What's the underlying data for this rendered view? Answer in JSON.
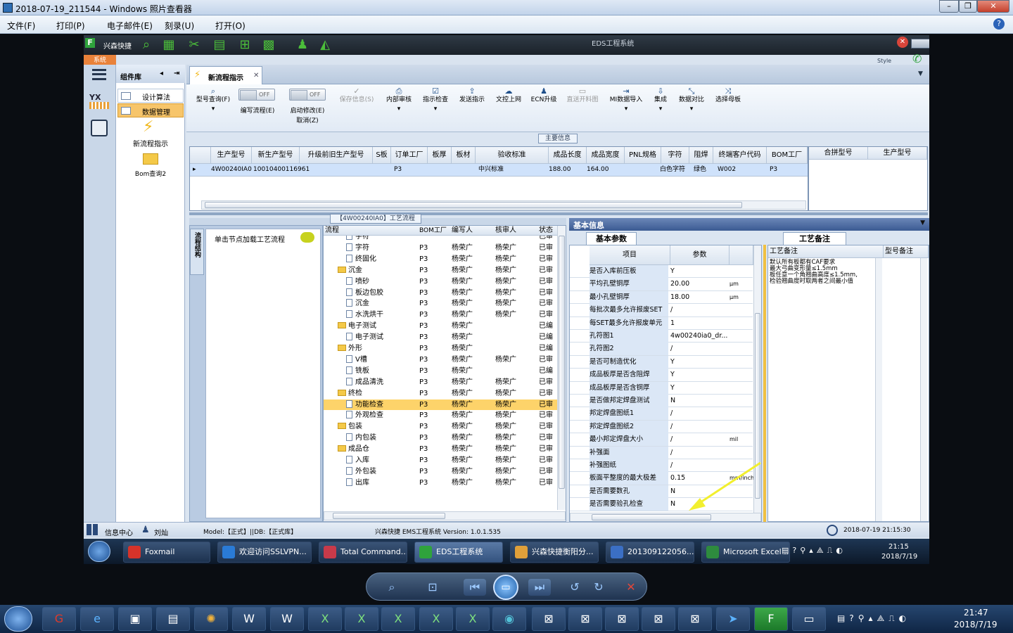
{
  "window": {
    "title": "2018-07-19_211544 - Windows 照片查看器"
  },
  "menu": [
    {
      "label": "文件(F)"
    },
    {
      "label": "打印(P)"
    },
    {
      "label": "电子邮件(E)"
    },
    {
      "label": "刻录(U)"
    },
    {
      "label": "打开(O)"
    }
  ],
  "eds": {
    "brand": "兴森快捷",
    "app_title": "EDS工程系统",
    "style_label": "Style",
    "sys_tab": "系统",
    "component_library": "组件库",
    "components": [
      {
        "label": "设计算法"
      },
      {
        "label": "数据管理"
      }
    ],
    "shortcuts": [
      {
        "label": "新流程指示"
      },
      {
        "label": "Bom查询2"
      }
    ],
    "tab": "新流程指示",
    "ribbon": {
      "query": "型号查询(F)",
      "toggle1": "OFF",
      "toggle1_label": "编写流程(E)",
      "toggle2": "OFF",
      "toggle2_label": "启动修改(E)",
      "cancel": "取消(Z)",
      "buttons": [
        {
          "label": "保存信息(S)"
        },
        {
          "label": "内部审核"
        },
        {
          "label": "指示检查"
        },
        {
          "label": "发送指示"
        },
        {
          "label": "文控上网"
        },
        {
          "label": "ECN升级"
        },
        {
          "label": "直送开料图"
        },
        {
          "label": "MI数据导入"
        },
        {
          "label": "集成"
        },
        {
          "label": "数据对比"
        },
        {
          "label": "选择母板"
        }
      ]
    },
    "main_info": "主要信息",
    "grid": {
      "headers": [
        "生产型号",
        "新生产型号",
        "升级前旧生产型号",
        "S板",
        "订单工厂",
        "板厚",
        "板材",
        "验收标准",
        "成品长度",
        "成品宽度",
        "PNL规格",
        "字符",
        "阻焊",
        "终端客户代码",
        "BOM工厂"
      ],
      "row": [
        "4W00240IA0",
        "10010400116961",
        "",
        "",
        "P3",
        "",
        "",
        "中兴标准",
        "188.00",
        "164.00",
        "",
        "白色字符",
        "绿色",
        "W002",
        "P3"
      ]
    },
    "merge_grid": {
      "headers": [
        "合拼型号",
        "生产型号"
      ]
    },
    "process_title": "【4W00240IA0】工艺流程",
    "struct_tab": "流程结构",
    "load_hint": "单击节点加载工艺流程",
    "tree": {
      "headers": [
        "流程",
        "BOM工厂",
        "编写人",
        "核审人",
        "状态"
      ],
      "rows": [
        {
          "name": "字符",
          "level": 2,
          "bom": "",
          "writer": "",
          "checker": "",
          "status": "已审"
        },
        {
          "name": "字符",
          "level": 2,
          "bom": "P3",
          "writer": "杨荣广",
          "checker": "杨荣广",
          "status": "已审"
        },
        {
          "name": "终固化",
          "level": 2,
          "bom": "P3",
          "writer": "杨荣广",
          "checker": "杨荣广",
          "status": "已审"
        },
        {
          "name": "沉金",
          "level": 1,
          "bom": "P3",
          "writer": "杨荣广",
          "checker": "杨荣广",
          "status": "已审"
        },
        {
          "name": "喷砂",
          "level": 2,
          "bom": "P3",
          "writer": "杨荣广",
          "checker": "杨荣广",
          "status": "已审"
        },
        {
          "name": "板边包胶",
          "level": 2,
          "bom": "P3",
          "writer": "杨荣广",
          "checker": "杨荣广",
          "status": "已审"
        },
        {
          "name": "沉金",
          "level": 2,
          "bom": "P3",
          "writer": "杨荣广",
          "checker": "杨荣广",
          "status": "已审"
        },
        {
          "name": "水洗烘干",
          "level": 2,
          "bom": "P3",
          "writer": "杨荣广",
          "checker": "杨荣广",
          "status": "已审"
        },
        {
          "name": "电子测试",
          "level": 1,
          "bom": "P3",
          "writer": "杨荣广",
          "checker": "",
          "status": "已编"
        },
        {
          "name": "电子测试",
          "level": 2,
          "bom": "P3",
          "writer": "杨荣广",
          "checker": "",
          "status": "已编"
        },
        {
          "name": "外形",
          "level": 1,
          "bom": "P3",
          "writer": "杨荣广",
          "checker": "",
          "status": "已编"
        },
        {
          "name": "V槽",
          "level": 2,
          "bom": "P3",
          "writer": "杨荣广",
          "checker": "杨荣广",
          "status": "已审"
        },
        {
          "name": "铣板",
          "level": 2,
          "bom": "P3",
          "writer": "杨荣广",
          "checker": "",
          "status": "已编"
        },
        {
          "name": "成品清洗",
          "level": 2,
          "bom": "P3",
          "writer": "杨荣广",
          "checker": "杨荣广",
          "status": "已审"
        },
        {
          "name": "终检",
          "level": 1,
          "bom": "P3",
          "writer": "杨荣广",
          "checker": "杨荣广",
          "status": "已审"
        },
        {
          "name": "功能检查",
          "level": 2,
          "bom": "P3",
          "writer": "杨荣广",
          "checker": "杨荣广",
          "status": "已审",
          "selected": true
        },
        {
          "name": "外观检查",
          "level": 2,
          "bom": "P3",
          "writer": "杨荣广",
          "checker": "杨荣广",
          "status": "已审"
        },
        {
          "name": "包装",
          "level": 1,
          "bom": "P3",
          "writer": "杨荣广",
          "checker": "杨荣广",
          "status": "已审"
        },
        {
          "name": "内包装",
          "level": 2,
          "bom": "P3",
          "writer": "杨荣广",
          "checker": "杨荣广",
          "status": "已审"
        },
        {
          "name": "成品仓",
          "level": 1,
          "bom": "P3",
          "writer": "杨荣广",
          "checker": "杨荣广",
          "status": "已审"
        },
        {
          "name": "入库",
          "level": 2,
          "bom": "P3",
          "writer": "杨荣广",
          "checker": "杨荣广",
          "status": "已审"
        },
        {
          "name": "外包装",
          "level": 2,
          "bom": "P3",
          "writer": "杨荣广",
          "checker": "杨荣广",
          "status": "已审"
        },
        {
          "name": "出库",
          "level": 2,
          "bom": "P3",
          "writer": "杨荣广",
          "checker": "杨荣广",
          "status": "已审"
        }
      ]
    },
    "basic_info": "基本信息",
    "basic_tab": "基本参数",
    "notes_tab": "工艺备注",
    "params": {
      "headers": [
        "项目",
        "参数"
      ],
      "rows": [
        {
          "k": "是否入库前压板",
          "v": "Y",
          "u": ""
        },
        {
          "k": "平均孔壁铜厚",
          "v": "20.00",
          "u": "μm"
        },
        {
          "k": "最小孔壁铜厚",
          "v": "18.00",
          "u": "μm"
        },
        {
          "k": "每批次最多允许报废SET",
          "v": "/",
          "u": ""
        },
        {
          "k": "每SET最多允许报废单元",
          "v": "1",
          "u": ""
        },
        {
          "k": "孔符图1",
          "v": "4w00240ia0_dr...",
          "u": ""
        },
        {
          "k": "孔符图2",
          "v": "/",
          "u": ""
        },
        {
          "k": "是否可制造优化",
          "v": "Y",
          "u": ""
        },
        {
          "k": "成品板厚是否含阻焊",
          "v": "Y",
          "u": ""
        },
        {
          "k": "成品板厚是否含铜厚",
          "v": "Y",
          "u": ""
        },
        {
          "k": "是否做邦定焊盘测试",
          "v": "N",
          "u": ""
        },
        {
          "k": "邦定焊盘图纸1",
          "v": "/",
          "u": ""
        },
        {
          "k": "邦定焊盘图纸2",
          "v": "/",
          "u": ""
        },
        {
          "k": "最小邦定焊盘大小",
          "v": "/",
          "u": "mil"
        },
        {
          "k": "补强面",
          "v": "/",
          "u": ""
        },
        {
          "k": "补强图纸",
          "v": "/",
          "u": ""
        },
        {
          "k": "板面平整度的最大极差",
          "v": "0.15",
          "u": "mm/inch"
        },
        {
          "k": "是否需要数孔",
          "v": "N",
          "u": ""
        },
        {
          "k": "是否需要验孔检查",
          "v": "N",
          "u": ""
        }
      ]
    },
    "notes": {
      "headers": [
        "工艺备注",
        "型号备注"
      ],
      "text": [
        "默认所有板都有CAF要求",
        "最大弓曲变形量≤1.5mm",
        "板任意一个角翘曲高度≤1.5mm,",
        "检验翘曲度时取两者之间最小值"
      ]
    },
    "status": {
      "info_center": "信息中心",
      "user": "刘灿",
      "model": "Model:【正式】||DB:【正式库】",
      "version": "兴森快捷 EMS工程系统 Version: 1.0.1.535",
      "datetime": "2018-07-19 21:15:30"
    }
  },
  "inner_taskbar": {
    "items": [
      {
        "label": "Foxmail",
        "color": "#d6332a"
      },
      {
        "label": "欢迎访问SSLVPN...",
        "color": "#2a7bd6"
      },
      {
        "label": "Total Command...",
        "color": "#c83a4a"
      },
      {
        "label": "EDS工程系统",
        "color": "#2fa33c"
      },
      {
        "label": "兴森快捷衡阳分...",
        "color": "#e0a03a"
      },
      {
        "label": "201309122056...",
        "color": "#3b6fc4"
      },
      {
        "label": "Microsoft Excel ...",
        "color": "#2e8b3e"
      }
    ],
    "time": "21:15",
    "date": "2018/7/19"
  },
  "taskbar": {
    "time": "21:47",
    "date": "2018/7/19"
  },
  "colors": {
    "selected_row": "#fdd36a",
    "grid_row": "#cfe2fb",
    "param_key_bg": "#dbe7f6",
    "annotation_arrow": "#f2ef2e"
  }
}
